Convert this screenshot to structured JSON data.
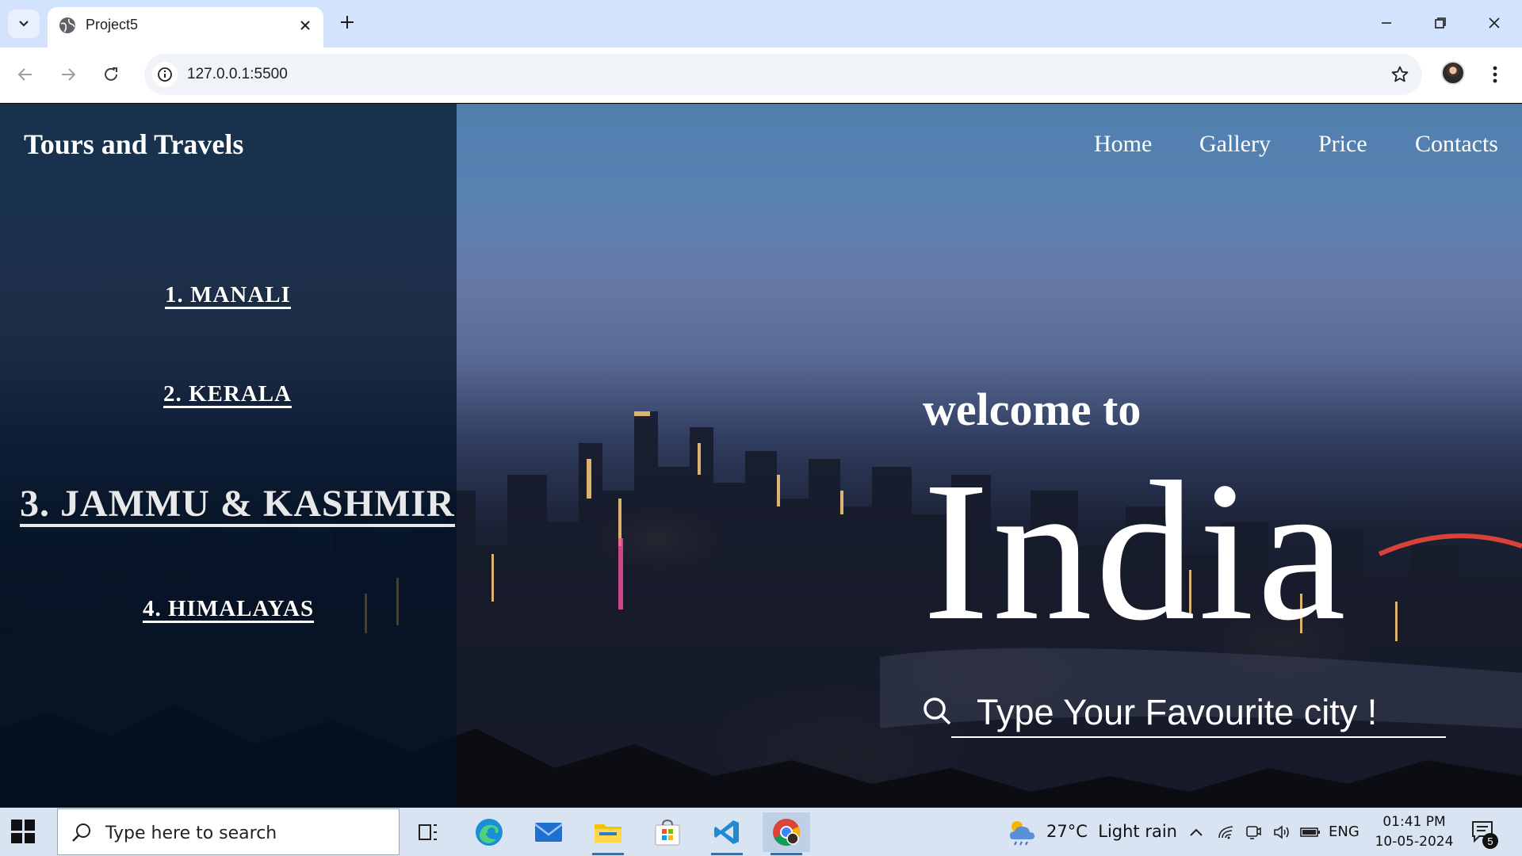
{
  "browser": {
    "tab_title": "Project5",
    "url": "127.0.0.1:5500"
  },
  "site": {
    "brand": "Tours and Travels",
    "nav": [
      "Home",
      "Gallery",
      "Price",
      "Contacts"
    ],
    "destinations": [
      "1. MANALI",
      "2. KERALA",
      "3. JAMMU & KASHMIR",
      "4. HIMALAYAS"
    ],
    "hero": {
      "welcome": "welcome to",
      "country": "India",
      "search_placeholder": "Type Your Favourite city !"
    }
  },
  "taskbar": {
    "search_placeholder": "Type here to search",
    "weather": {
      "temperature": "27°C",
      "condition": "Light rain"
    },
    "language": "ENG",
    "time": "01:41 PM",
    "date": "10-05-2024",
    "notification_count": "5"
  }
}
